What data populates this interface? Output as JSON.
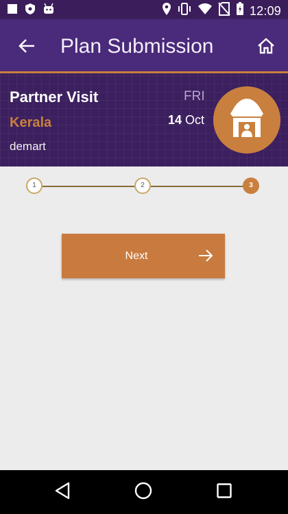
{
  "status_bar": {
    "time": "12:09",
    "left_icons": [
      "square-notification-icon",
      "shield-notification-icon",
      "android-notification-icon"
    ],
    "right_icons": [
      "location-icon",
      "vibrate-icon",
      "wifi-icon",
      "no-sim-icon",
      "battery-icon"
    ]
  },
  "app_bar": {
    "title": "Plan Submission",
    "back_icon": "back-arrow-icon",
    "home_icon": "home-icon"
  },
  "visit": {
    "title": "Partner Visit",
    "state": "Kerala",
    "store": "demart",
    "weekday": "FRI",
    "day": "14",
    "month": "Oct",
    "badge_icon": "shop-icon"
  },
  "stepper": {
    "steps": [
      {
        "label": "1",
        "active": false
      },
      {
        "label": "2",
        "active": false
      },
      {
        "label": "3",
        "active": true
      }
    ]
  },
  "actions": {
    "next_label": "Next",
    "next_icon": "arrow-right-icon"
  },
  "nav_bar": {
    "icons": [
      "back-triangle-icon",
      "home-circle-icon",
      "recents-square-icon"
    ]
  },
  "colors": {
    "primary": "#4a2a7a",
    "status_bar": "#3a1d5a",
    "accent": "#c97a3e",
    "card": "#3b1f5e",
    "background": "#ececec"
  }
}
